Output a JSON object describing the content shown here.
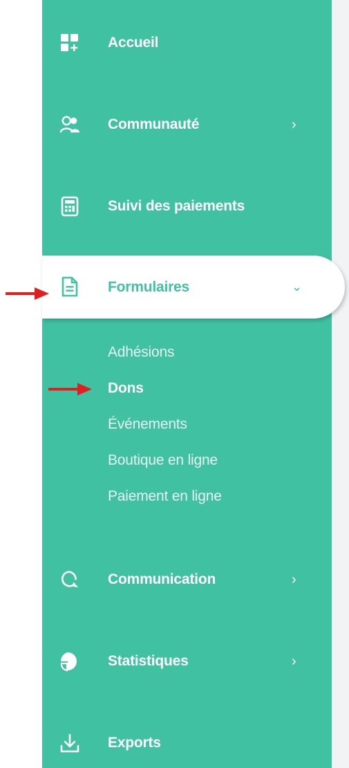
{
  "nav": {
    "items": [
      {
        "label": "Accueil",
        "icon": "dashboard-icon"
      },
      {
        "label": "Communauté",
        "icon": "users-icon",
        "chevron": "›"
      },
      {
        "label": "Suivi des paiements",
        "icon": "calculator-icon"
      },
      {
        "label": "Formulaires",
        "icon": "document-icon",
        "chevron": "⌄"
      },
      {
        "label": "Communication",
        "icon": "chat-icon",
        "chevron": "›"
      },
      {
        "label": "Statistiques",
        "icon": "pie-chart-icon",
        "chevron": "›"
      },
      {
        "label": "Exports",
        "icon": "download-icon"
      }
    ],
    "active_index": 3
  },
  "submenu": {
    "items": [
      {
        "label": "Adhésions"
      },
      {
        "label": "Dons"
      },
      {
        "label": "Événements"
      },
      {
        "label": "Boutique en ligne"
      },
      {
        "label": "Paiement en ligne"
      }
    ],
    "current_index": 1
  },
  "colors": {
    "sidebar_bg": "#40c2a2",
    "active_bg": "#ffffff",
    "active_text": "#40c2a2",
    "annotation_arrow": "#e02020"
  }
}
